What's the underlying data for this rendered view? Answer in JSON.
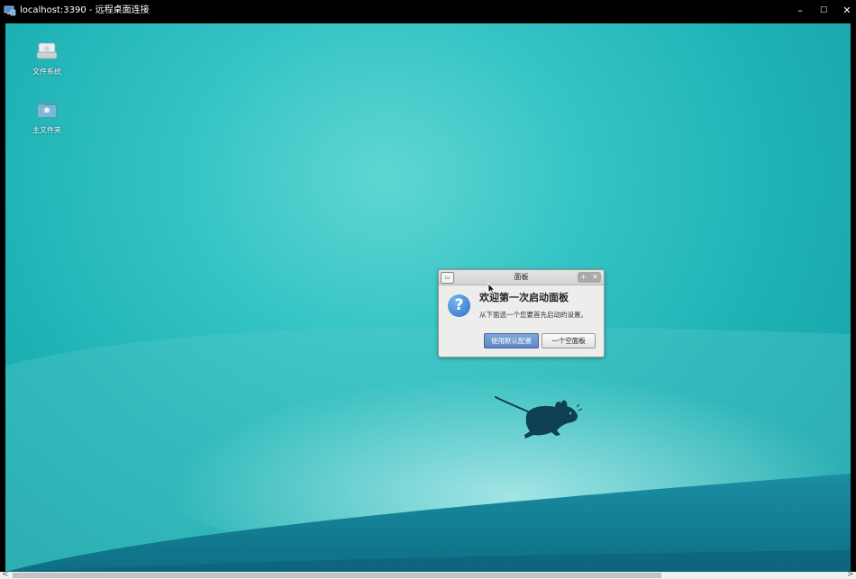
{
  "window": {
    "title": "localhost:3390 - 远程桌面连接",
    "minimize_glyph": "–",
    "maximize_glyph": "☐",
    "close_glyph": "✕"
  },
  "desktop": {
    "icons": [
      {
        "label": "文件系统",
        "icon": "drive-icon"
      },
      {
        "label": "主文件夹",
        "icon": "home-folder-icon"
      }
    ]
  },
  "dialog": {
    "title": "面板",
    "heading": "欢迎第一次启动面板",
    "message": "从下面选一个您要首先启动的设置。",
    "buttons": {
      "default_config": "使用默认配置",
      "empty_panel": "一个空面板"
    }
  },
  "scrollbar": {
    "left_arrow": "<",
    "right_arrow": ">"
  },
  "colors": {
    "accent": "#5e88c4",
    "desktop": "#1fb2b5"
  }
}
